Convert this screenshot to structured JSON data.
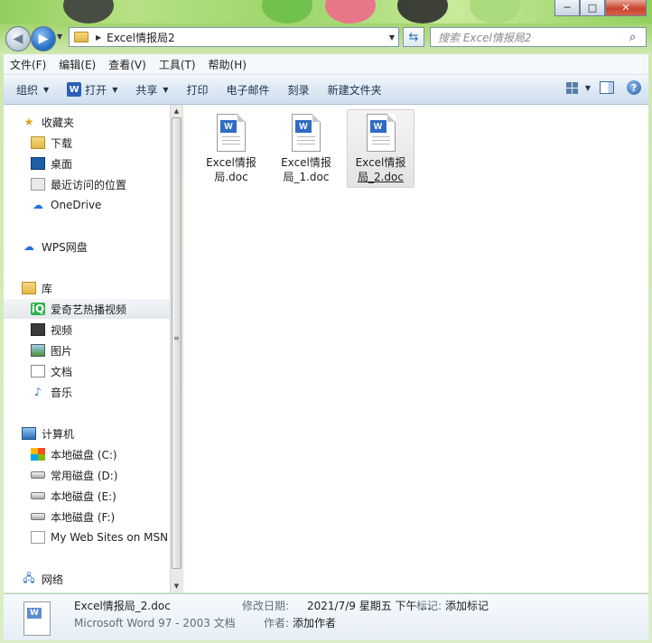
{
  "window": {
    "caption": {
      "minimize": "─",
      "maximize": "□",
      "close": "✕"
    }
  },
  "address_bar": {
    "path": "Excel情报局2",
    "search_placeholder": "搜索 Excel情报局2"
  },
  "menu": [
    "文件(F)",
    "编辑(E)",
    "查看(V)",
    "工具(T)",
    "帮助(H)"
  ],
  "toolbar": {
    "organize": "组织",
    "open": "打开",
    "share": "共享",
    "print": "打印",
    "email": "电子邮件",
    "burn": "刻录",
    "new_folder": "新建文件夹"
  },
  "nav": {
    "favorites": "收藏夹",
    "downloads": "下载",
    "desktop": "桌面",
    "recent": "最近访问的位置",
    "onedrive": "OneDrive",
    "wps": "WPS网盘",
    "libraries": "库",
    "iqiyi": "爱奇艺热播视频",
    "videos": "视频",
    "pictures": "图片",
    "documents": "文档",
    "music": "音乐",
    "computer": "计算机",
    "drive_c": "本地磁盘 (C:)",
    "drive_d": "常用磁盘 (D:)",
    "drive_e": "本地磁盘 (E:)",
    "drive_f": "本地磁盘 (F:)",
    "msn": "My Web Sites on MSN",
    "network": "网络"
  },
  "files": [
    {
      "name_line1": "Excel情报",
      "name_line2": "局.doc"
    },
    {
      "name_line1": "Excel情报",
      "name_line2": "局_1.doc"
    },
    {
      "name_line1": "Excel情报",
      "name_line2": "局_2.doc"
    }
  ],
  "details": {
    "name": "Excel情报局_2.doc",
    "type": "Microsoft Word 97 - 2003 文档",
    "modified_label": "修改日期:",
    "modified_value": "2021/7/9 星期五 下午 ...",
    "tags_label": "标记:",
    "tags_value": "添加标记",
    "author_label": "作者:",
    "author_value": "添加作者"
  }
}
